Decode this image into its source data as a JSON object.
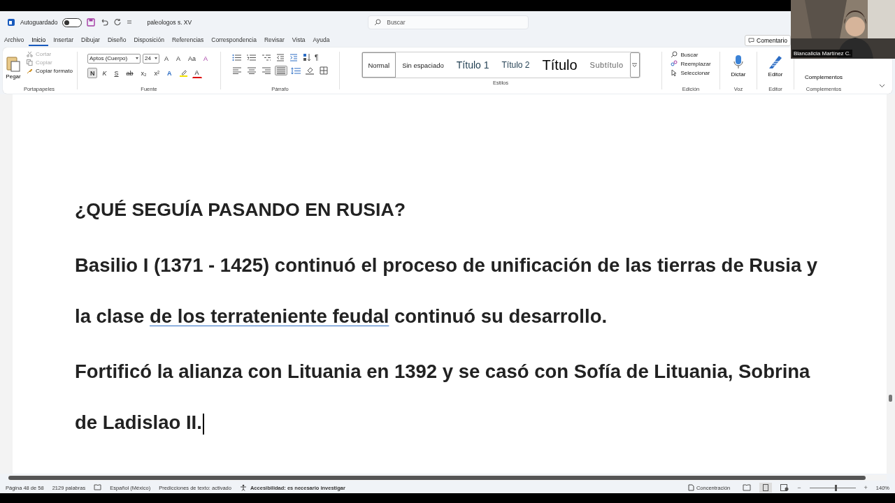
{
  "titlebar": {
    "autosave_label": "Autoguardado",
    "autosave_on": false,
    "document_title": "paleologos s. XV",
    "search": {
      "placeholder": "Buscar"
    }
  },
  "menu_tabs": [
    {
      "label": "Archivo",
      "selected": false
    },
    {
      "label": "Inicio",
      "selected": true
    },
    {
      "label": "Insertar",
      "selected": false
    },
    {
      "label": "Dibujar",
      "selected": false
    },
    {
      "label": "Diseño",
      "selected": false
    },
    {
      "label": "Disposición",
      "selected": false
    },
    {
      "label": "Referencias",
      "selected": false
    },
    {
      "label": "Correspondencia",
      "selected": false
    },
    {
      "label": "Revisar",
      "selected": false
    },
    {
      "label": "Vista",
      "selected": false
    },
    {
      "label": "Ayuda",
      "selected": false
    }
  ],
  "comments_button": "Comentario",
  "ribbon": {
    "clipboard": {
      "paste": "Pegar",
      "items": [
        {
          "kind": "cut",
          "label": "Cortar",
          "disabled": true
        },
        {
          "kind": "copy",
          "label": "Copiar",
          "disabled": true
        },
        {
          "kind": "format",
          "label": "Copiar formato",
          "disabled": false
        }
      ],
      "group": "Portapapeles"
    },
    "font": {
      "name": "Aptos (Cuerpo)",
      "size": "24",
      "tools": [
        {
          "kind": "grow",
          "label": "A"
        },
        {
          "kind": "shrink",
          "label": "A"
        },
        {
          "kind": "case",
          "label": "Aa"
        },
        {
          "kind": "clear",
          "label": "A"
        }
      ],
      "format_buttons": [
        {
          "kind": "bold",
          "label": "N",
          "selected": true
        },
        {
          "kind": "italic",
          "label": "K",
          "selected": false
        },
        {
          "kind": "underline",
          "label": "S",
          "selected": false
        },
        {
          "kind": "strike",
          "label": "ab",
          "selected": false
        },
        {
          "kind": "sub",
          "label": "x₂",
          "selected": false
        },
        {
          "kind": "sup",
          "label": "x²",
          "selected": false
        }
      ],
      "effects": [
        {
          "kind": "effects",
          "label": "A"
        },
        {
          "kind": "highlight"
        },
        {
          "kind": "color",
          "label": "A"
        }
      ],
      "group": "Fuente"
    },
    "paragraph": {
      "pilcrow": "¶",
      "align": [
        {
          "selected": false
        },
        {
          "selected": false
        },
        {
          "selected": false
        },
        {
          "selected": true
        }
      ],
      "group": "Párrafo"
    },
    "styles": {
      "items": [
        {
          "label": "Normal",
          "kind": "normal",
          "selected": true
        },
        {
          "label": "Sin espaciado",
          "kind": "normal",
          "selected": false
        },
        {
          "label": "Título 1",
          "kind": "h1",
          "selected": false
        },
        {
          "label": "Título 2",
          "kind": "h2",
          "selected": false
        },
        {
          "label": "Título",
          "kind": "title",
          "selected": false
        },
        {
          "label": "Subtítulo",
          "kind": "subtitle",
          "selected": false
        }
      ],
      "group": "Estilos"
    },
    "editing": {
      "items": [
        {
          "kind": "find",
          "label": "Buscar"
        },
        {
          "kind": "replace",
          "label": "Reemplazar"
        },
        {
          "kind": "select",
          "label": "Seleccionar"
        }
      ],
      "group": "Edición"
    },
    "voice": {
      "label": "Dictar",
      "group": "Voz"
    },
    "editor": {
      "label": "Editor",
      "group": "Editor"
    },
    "addins": {
      "label": "Complementos",
      "group": "Complementos"
    }
  },
  "document": {
    "heading": "¿QUÉ SEGUÍA PASANDO EN RUSIA?",
    "paragraphs": [
      {
        "lines": [
          [
            {
              "text": "Basilio I (1371 - 1425) continuó el proceso de unificación de las tierras de Rusia y",
              "flagged": false
            }
          ],
          [
            {
              "text": "la clase ",
              "flagged": false
            },
            {
              "text": "de los terrateniente feudal",
              "flagged": true
            },
            {
              "text": " continuó su desarrollo.",
              "flagged": false
            }
          ]
        ],
        "cursor": false
      },
      {
        "lines": [
          [
            {
              "text": "Fortificó la alianza con Lituania en 1392 y se casó con Sofía de Lituania, Sobrina",
              "flagged": false
            }
          ],
          [
            {
              "text": "de Ladislao II.",
              "flagged": false
            }
          ]
        ],
        "cursor": true
      }
    ]
  },
  "status_bar": {
    "page": "Página 48 de 58",
    "words": "2129 palabras",
    "language": "Español (México)",
    "predictions": "Predicciones de texto: activado",
    "accessibility": "Accesibilidad: es necesario investigar",
    "focus": "Concentración",
    "zoom": {
      "out": "−",
      "in": "+",
      "level": 0.55,
      "reading": "140%"
    }
  },
  "webcam": {
    "kind": "picture",
    "name": "Blancalicia Martínez C."
  }
}
